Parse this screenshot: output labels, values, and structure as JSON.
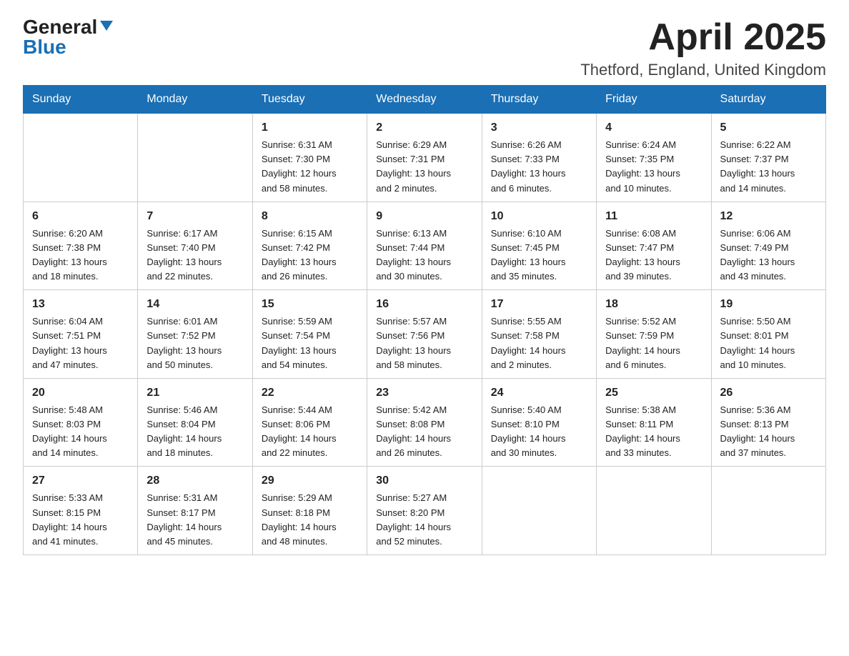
{
  "header": {
    "logo_general": "General",
    "logo_blue": "Blue",
    "month_title": "April 2025",
    "location": "Thetford, England, United Kingdom"
  },
  "weekdays": [
    "Sunday",
    "Monday",
    "Tuesday",
    "Wednesday",
    "Thursday",
    "Friday",
    "Saturday"
  ],
  "weeks": [
    [
      {
        "day": "",
        "info": ""
      },
      {
        "day": "",
        "info": ""
      },
      {
        "day": "1",
        "info": "Sunrise: 6:31 AM\nSunset: 7:30 PM\nDaylight: 12 hours\nand 58 minutes."
      },
      {
        "day": "2",
        "info": "Sunrise: 6:29 AM\nSunset: 7:31 PM\nDaylight: 13 hours\nand 2 minutes."
      },
      {
        "day": "3",
        "info": "Sunrise: 6:26 AM\nSunset: 7:33 PM\nDaylight: 13 hours\nand 6 minutes."
      },
      {
        "day": "4",
        "info": "Sunrise: 6:24 AM\nSunset: 7:35 PM\nDaylight: 13 hours\nand 10 minutes."
      },
      {
        "day": "5",
        "info": "Sunrise: 6:22 AM\nSunset: 7:37 PM\nDaylight: 13 hours\nand 14 minutes."
      }
    ],
    [
      {
        "day": "6",
        "info": "Sunrise: 6:20 AM\nSunset: 7:38 PM\nDaylight: 13 hours\nand 18 minutes."
      },
      {
        "day": "7",
        "info": "Sunrise: 6:17 AM\nSunset: 7:40 PM\nDaylight: 13 hours\nand 22 minutes."
      },
      {
        "day": "8",
        "info": "Sunrise: 6:15 AM\nSunset: 7:42 PM\nDaylight: 13 hours\nand 26 minutes."
      },
      {
        "day": "9",
        "info": "Sunrise: 6:13 AM\nSunset: 7:44 PM\nDaylight: 13 hours\nand 30 minutes."
      },
      {
        "day": "10",
        "info": "Sunrise: 6:10 AM\nSunset: 7:45 PM\nDaylight: 13 hours\nand 35 minutes."
      },
      {
        "day": "11",
        "info": "Sunrise: 6:08 AM\nSunset: 7:47 PM\nDaylight: 13 hours\nand 39 minutes."
      },
      {
        "day": "12",
        "info": "Sunrise: 6:06 AM\nSunset: 7:49 PM\nDaylight: 13 hours\nand 43 minutes."
      }
    ],
    [
      {
        "day": "13",
        "info": "Sunrise: 6:04 AM\nSunset: 7:51 PM\nDaylight: 13 hours\nand 47 minutes."
      },
      {
        "day": "14",
        "info": "Sunrise: 6:01 AM\nSunset: 7:52 PM\nDaylight: 13 hours\nand 50 minutes."
      },
      {
        "day": "15",
        "info": "Sunrise: 5:59 AM\nSunset: 7:54 PM\nDaylight: 13 hours\nand 54 minutes."
      },
      {
        "day": "16",
        "info": "Sunrise: 5:57 AM\nSunset: 7:56 PM\nDaylight: 13 hours\nand 58 minutes."
      },
      {
        "day": "17",
        "info": "Sunrise: 5:55 AM\nSunset: 7:58 PM\nDaylight: 14 hours\nand 2 minutes."
      },
      {
        "day": "18",
        "info": "Sunrise: 5:52 AM\nSunset: 7:59 PM\nDaylight: 14 hours\nand 6 minutes."
      },
      {
        "day": "19",
        "info": "Sunrise: 5:50 AM\nSunset: 8:01 PM\nDaylight: 14 hours\nand 10 minutes."
      }
    ],
    [
      {
        "day": "20",
        "info": "Sunrise: 5:48 AM\nSunset: 8:03 PM\nDaylight: 14 hours\nand 14 minutes."
      },
      {
        "day": "21",
        "info": "Sunrise: 5:46 AM\nSunset: 8:04 PM\nDaylight: 14 hours\nand 18 minutes."
      },
      {
        "day": "22",
        "info": "Sunrise: 5:44 AM\nSunset: 8:06 PM\nDaylight: 14 hours\nand 22 minutes."
      },
      {
        "day": "23",
        "info": "Sunrise: 5:42 AM\nSunset: 8:08 PM\nDaylight: 14 hours\nand 26 minutes."
      },
      {
        "day": "24",
        "info": "Sunrise: 5:40 AM\nSunset: 8:10 PM\nDaylight: 14 hours\nand 30 minutes."
      },
      {
        "day": "25",
        "info": "Sunrise: 5:38 AM\nSunset: 8:11 PM\nDaylight: 14 hours\nand 33 minutes."
      },
      {
        "day": "26",
        "info": "Sunrise: 5:36 AM\nSunset: 8:13 PM\nDaylight: 14 hours\nand 37 minutes."
      }
    ],
    [
      {
        "day": "27",
        "info": "Sunrise: 5:33 AM\nSunset: 8:15 PM\nDaylight: 14 hours\nand 41 minutes."
      },
      {
        "day": "28",
        "info": "Sunrise: 5:31 AM\nSunset: 8:17 PM\nDaylight: 14 hours\nand 45 minutes."
      },
      {
        "day": "29",
        "info": "Sunrise: 5:29 AM\nSunset: 8:18 PM\nDaylight: 14 hours\nand 48 minutes."
      },
      {
        "day": "30",
        "info": "Sunrise: 5:27 AM\nSunset: 8:20 PM\nDaylight: 14 hours\nand 52 minutes."
      },
      {
        "day": "",
        "info": ""
      },
      {
        "day": "",
        "info": ""
      },
      {
        "day": "",
        "info": ""
      }
    ]
  ],
  "colors": {
    "header_bg": "#1a6fb5",
    "logo_blue": "#1a6fb5"
  }
}
